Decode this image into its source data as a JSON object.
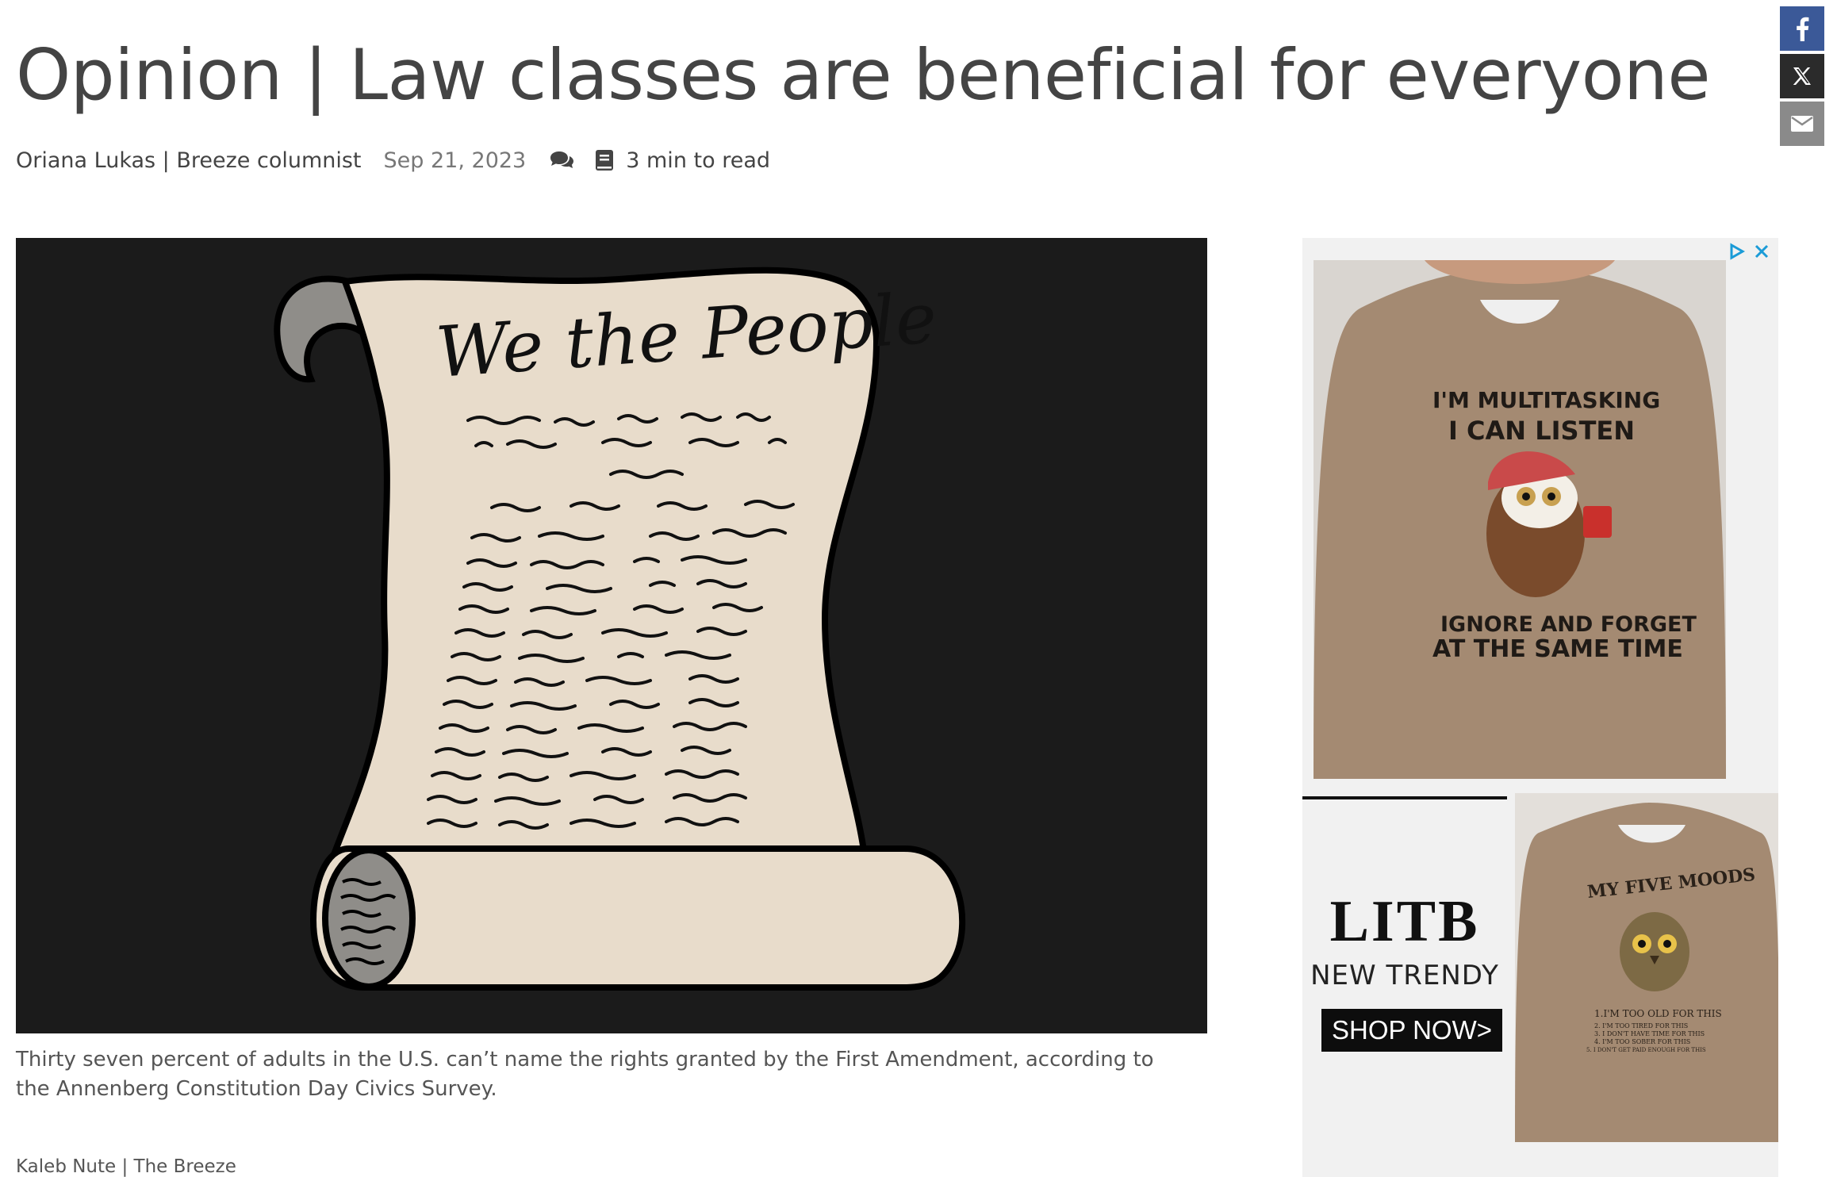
{
  "article": {
    "headline": "Opinion | Law classes are beneficial for everyone",
    "author": "Oriana Lukas | Breeze columnist",
    "date": "Sep 21, 2023",
    "read_time": "3 min to read",
    "image": {
      "title_script": "We the People"
    },
    "caption": "Thirty seven percent of adults in the U.S. can’t name the rights granted by the First Amendment, according to the Annenberg Constitution Day Civics Survey.",
    "credit": "Kaleb Nute | The Breeze"
  },
  "share": {
    "icons": [
      "facebook-icon",
      "x-icon",
      "email-icon"
    ],
    "colors": {
      "facebook": "#3b5998",
      "x": "#2b2b2b",
      "email": "#8a8a8a"
    }
  },
  "ad": {
    "top_shirt_lines": [
      "I'M MULTITASKING",
      "I CAN LISTEN",
      "IGNORE AND FORGET",
      "AT THE SAME TIME"
    ],
    "brand": "LITB",
    "tagline": "NEW TRENDY",
    "cta": "SHOP NOW>",
    "bottom_shirt_title": "MY FIVE MOODS",
    "bottom_shirt_lines": [
      "1.I'M TOO OLD FOR THIS",
      "2. I'M TOO TIRED FOR THIS",
      "3. I DON'T HAVE TIME FOR THIS",
      "4. I'M TOO SOBER FOR THIS",
      "5. I DON'T GET PAID ENOUGH FOR THIS"
    ],
    "accent_color": "#1a9bd7"
  }
}
